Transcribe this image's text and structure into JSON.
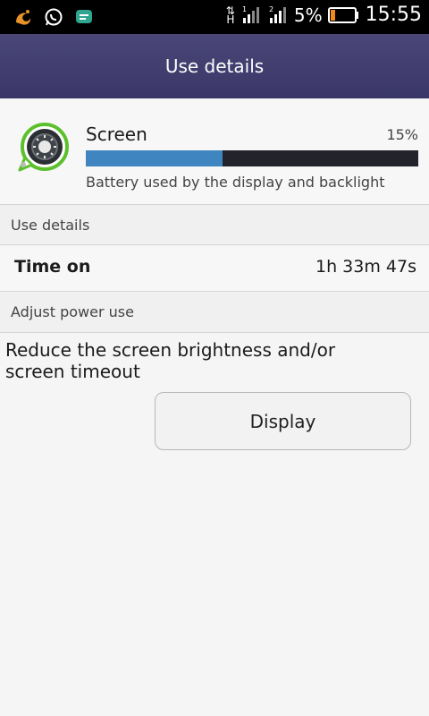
{
  "status_bar": {
    "network_type": "H",
    "sim1_label": "1",
    "sim2_label": "2",
    "battery_percent": "5%",
    "time": "15:55",
    "notification_icons": [
      "uc-browser-icon",
      "whatsapp-icon",
      "chat-bubble-icon"
    ]
  },
  "app_bar": {
    "title": "Use details"
  },
  "usage_item": {
    "name": "Screen",
    "percent_text": "15%",
    "percent_value": 0.41,
    "description": "Battery used by the display and backlight",
    "icon": "screen-brightness-icon"
  },
  "sections": {
    "use_details": "Use details",
    "adjust_power_use": "Adjust power use"
  },
  "time_on": {
    "label": "Time on",
    "value": "1h 33m 47s"
  },
  "advice": {
    "text": "Reduce the screen brightness and/or screen timeout",
    "button_label": "Display"
  },
  "colors": {
    "appbar": "#4a4777",
    "bar_fill": "#3f85c0",
    "bar_track": "#23232b",
    "icon_ring": "#5cc02c"
  }
}
